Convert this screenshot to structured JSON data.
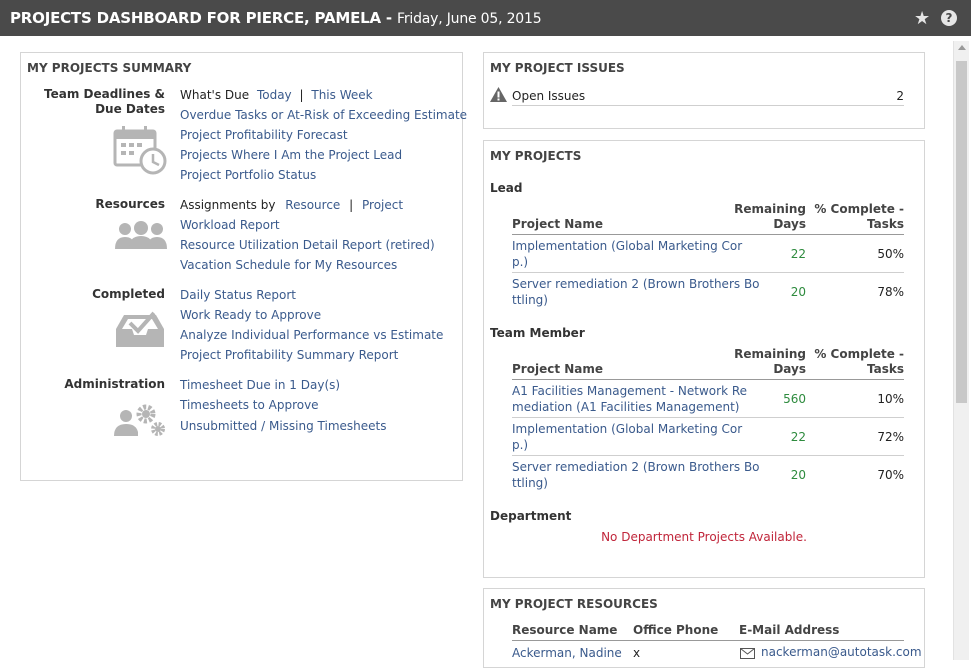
{
  "header": {
    "title": "PROJECTS DASHBOARD FOR PIERCE, PAMELA -",
    "date": "Friday, June 05, 2015",
    "star_icon": "star-icon",
    "help_icon": "help-icon"
  },
  "summary": {
    "title": "MY PROJECTS SUMMARY",
    "team_deadlines": {
      "label_1": "Team Deadlines &",
      "label_2": "Due Dates",
      "whats_due": "What's Due",
      "today": "Today",
      "sep": "|",
      "this_week": "This Week",
      "links": [
        "Overdue Tasks or At-Risk of Exceeding Estimate",
        "Project Profitability Forecast",
        "Projects Where I Am the Project Lead",
        "Project Portfolio Status"
      ]
    },
    "resources": {
      "label": "Resources",
      "assignments_by": "Assignments by",
      "resource": "Resource",
      "sep": "|",
      "project": "Project",
      "links": [
        "Workload Report",
        "Resource Utilization Detail Report (retired)",
        "Vacation Schedule for My Resources"
      ]
    },
    "completed": {
      "label": "Completed",
      "links": [
        "Daily Status Report",
        "Work Ready to Approve",
        "Analyze Individual Performance vs Estimate",
        "Project Profitability Summary Report"
      ]
    },
    "administration": {
      "label": "Administration",
      "links": [
        "Timesheet Due in 1 Day(s)",
        "Timesheets to Approve",
        "Unsubmitted / Missing Timesheets"
      ]
    }
  },
  "issues": {
    "title": "MY PROJECT ISSUES",
    "label": "Open Issues",
    "count": "2"
  },
  "projects": {
    "title": "MY PROJECTS",
    "lead_label": "Lead",
    "team_label": "Team Member",
    "dept_label": "Department",
    "col_name": "Project Name",
    "col_remaining_1": "Remaining",
    "col_remaining_2": "Days",
    "col_complete_1": "% Complete -",
    "col_complete_2": "Tasks",
    "lead_rows": [
      {
        "name_1": "Implementation (Global Marketing Cor",
        "name_2": "p.)",
        "days": "22",
        "pct": "50%"
      },
      {
        "name_1": "Server remediation 2 (Brown Brothers Bo",
        "name_2": "ttling)",
        "days": "20",
        "pct": "78%"
      }
    ],
    "team_rows": [
      {
        "name_1": "A1 Facilities Management - Network Re",
        "name_2": "mediation (A1 Facilities Management)",
        "days": "560",
        "pct": "10%"
      },
      {
        "name_1": "Implementation (Global Marketing Cor",
        "name_2": "p.)",
        "days": "22",
        "pct": "72%"
      },
      {
        "name_1": "Server remediation 2 (Brown Brothers Bo",
        "name_2": "ttling)",
        "days": "20",
        "pct": "70%"
      }
    ],
    "no_dept": "No Department Projects Available."
  },
  "resources_panel": {
    "title": "MY PROJECT RESOURCES",
    "col_name": "Resource Name",
    "col_phone": "Office Phone",
    "col_email": "E-Mail Address",
    "rows": [
      {
        "name": "Ackerman, Nadine",
        "phone": "x",
        "email": "nackerman@autotask.com"
      }
    ]
  },
  "colors": {
    "titlebar": "#4a4a4a",
    "link": "#3a5a8c",
    "green": "#2e8b3e",
    "red": "#c0253a"
  }
}
